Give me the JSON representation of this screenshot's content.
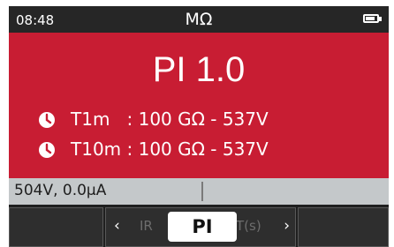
{
  "status_bar": {
    "time": "08:48",
    "unit": "MΩ",
    "battery_icon": "battery-full-icon"
  },
  "result": {
    "title": "PI 1.0",
    "rows": [
      {
        "icon": "clock-icon",
        "text": "T1m   : 100 GΩ - 537V"
      },
      {
        "icon": "clock-icon",
        "text": "T10m : 100 GΩ - 537V"
      }
    ]
  },
  "voltage_bar": {
    "text": "504V, 0.0μA"
  },
  "softkeys": {
    "left_arrow": "‹",
    "right_arrow": "›",
    "prev_item": "IR",
    "selected": "PI",
    "next_item": "T(s)"
  },
  "colors": {
    "result_background": "#c81d33",
    "status_background": "#262626",
    "voltage_background": "#c4c8ca",
    "softkey_background": "#1f1f1f"
  }
}
